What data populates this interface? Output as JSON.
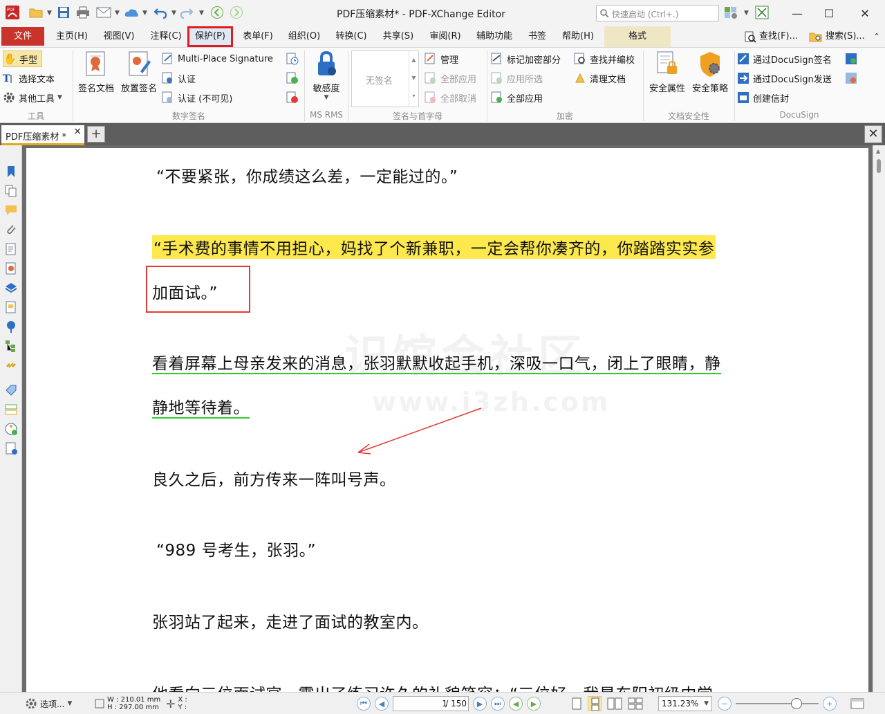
{
  "window": {
    "title": "PDF压缩素材* - PDF-XChange Editor",
    "search_placeholder": "快速启动 (Ctrl+.)",
    "minimize": "—",
    "maximize": "☐",
    "close": "✕"
  },
  "menu": {
    "file": "文件",
    "home": "主页(H)",
    "view": "视图(V)",
    "comment": "注释(C)",
    "protect": "保护(P)",
    "form": "表单(F)",
    "organize": "组织(O)",
    "convert": "转换(C)",
    "share": "共享(S)",
    "review": "审阅(R)",
    "accessibility": "辅助功能",
    "bookmarks": "书签",
    "help": "帮助(H)",
    "format": "格式",
    "find": "查找(F)...",
    "search": "搜索(S)..."
  },
  "ribbon": {
    "tools": {
      "hand": "手型",
      "select_text": "选择文本",
      "other_tools": "其他工具",
      "label": "工具"
    },
    "digital_signature": {
      "sign_doc": "签名文档",
      "place_sig": "放置签名",
      "multi_place": "Multi-Place Signature",
      "certify": "认证",
      "certify_invisible": "认证 (不可见)",
      "label": "数字签名"
    },
    "ms_rms": {
      "sensitivity": "敏感度",
      "label": "MS RMS"
    },
    "sig_initials": {
      "no_signature": "无签名",
      "manage": "管理",
      "apply_all": "全部应用",
      "cancel_all": "全部取消",
      "label": "签名与首字母"
    },
    "encryption": {
      "mark_redact": "标记加密部分",
      "apply_selected": "应用所选",
      "apply_all": "全部应用",
      "find_redact": "查找并编校",
      "sanitize": "清理文档",
      "label": "加密"
    },
    "doc_security": {
      "props": "安全属性",
      "policy": "安全策略",
      "label": "文档安全性"
    },
    "docusign": {
      "sign_via": "通过DocuSign签名",
      "send_via": "通过DocuSign发送",
      "create_envelope": "创建信封",
      "label": "DocuSign"
    }
  },
  "document": {
    "tab_name": "PDF压缩素材 *",
    "tab_close": "×",
    "add_tab": "+",
    "lines": [
      "“不要紧张，你成绩这么差，一定能过的。”",
      "“手术费的事情不用担心，妈找了个新兼职，一定会帮你凑齐的，你踏踏实实参",
      "加面试。”",
      "看着屏幕上母亲发来的消息，张羽默默收起手机，深吸一口气，闭上了眼睛，静",
      "静地等待着。",
      "良久之后，前方传来一阵叫号声。",
      "“989 号考生，张羽。”",
      "张羽站了起来，走进了面试的教室内。",
      "他看向三位面试官，露出了练习许久的礼貌笑容：“三位好，我是东阳初级中学"
    ],
    "watermark_main": "识馆会社区",
    "watermark_url": "www.i3zh.com"
  },
  "status": {
    "options": "选项...",
    "width": "W : 210.01 mm",
    "height": "H : 297.00 mm",
    "x": "X :",
    "y": "Y :",
    "page_current": "1",
    "page_total": "/ 150",
    "zoom": "131.23%"
  }
}
